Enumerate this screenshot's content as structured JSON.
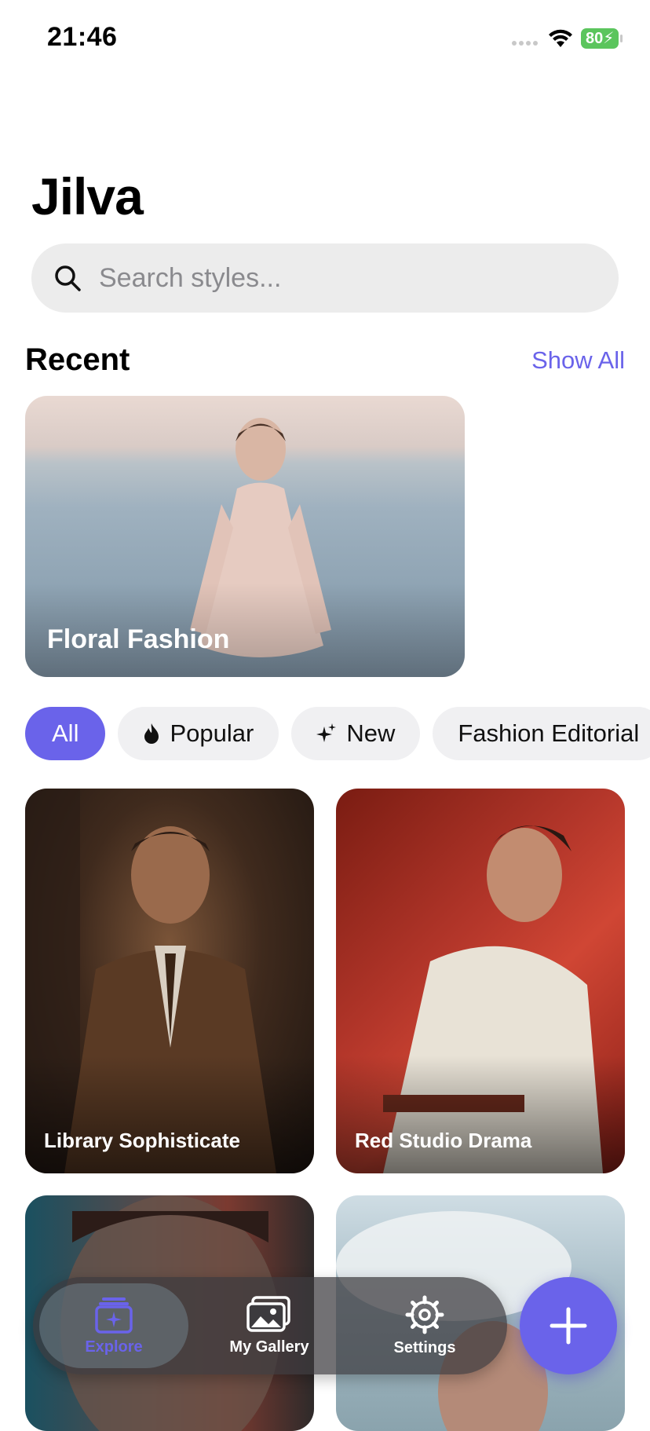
{
  "status_bar": {
    "time": "21:46",
    "battery": "80"
  },
  "app": {
    "title": "Jilva"
  },
  "search": {
    "placeholder": "Search styles..."
  },
  "recent": {
    "title": "Recent",
    "show_all": "Show All",
    "items": [
      {
        "label": "Floral Fashion"
      }
    ]
  },
  "filters": [
    {
      "label": "All",
      "active": true
    },
    {
      "label": "Popular",
      "icon": "flame-icon"
    },
    {
      "label": "New",
      "icon": "sparkle-icon"
    },
    {
      "label": "Fashion Editorial"
    }
  ],
  "styles": [
    {
      "label": "Library Sophisticate"
    },
    {
      "label": "Red Studio Drama"
    },
    {
      "label": ""
    },
    {
      "label": ""
    }
  ],
  "tabbar": {
    "tabs": [
      {
        "label": "Explore",
        "icon": "explore-icon",
        "active": true
      },
      {
        "label": "My Gallery",
        "icon": "gallery-icon"
      },
      {
        "label": "Settings",
        "icon": "gear-icon"
      }
    ]
  },
  "colors": {
    "accent": "#6a63ea",
    "battery": "#5bc55d"
  }
}
